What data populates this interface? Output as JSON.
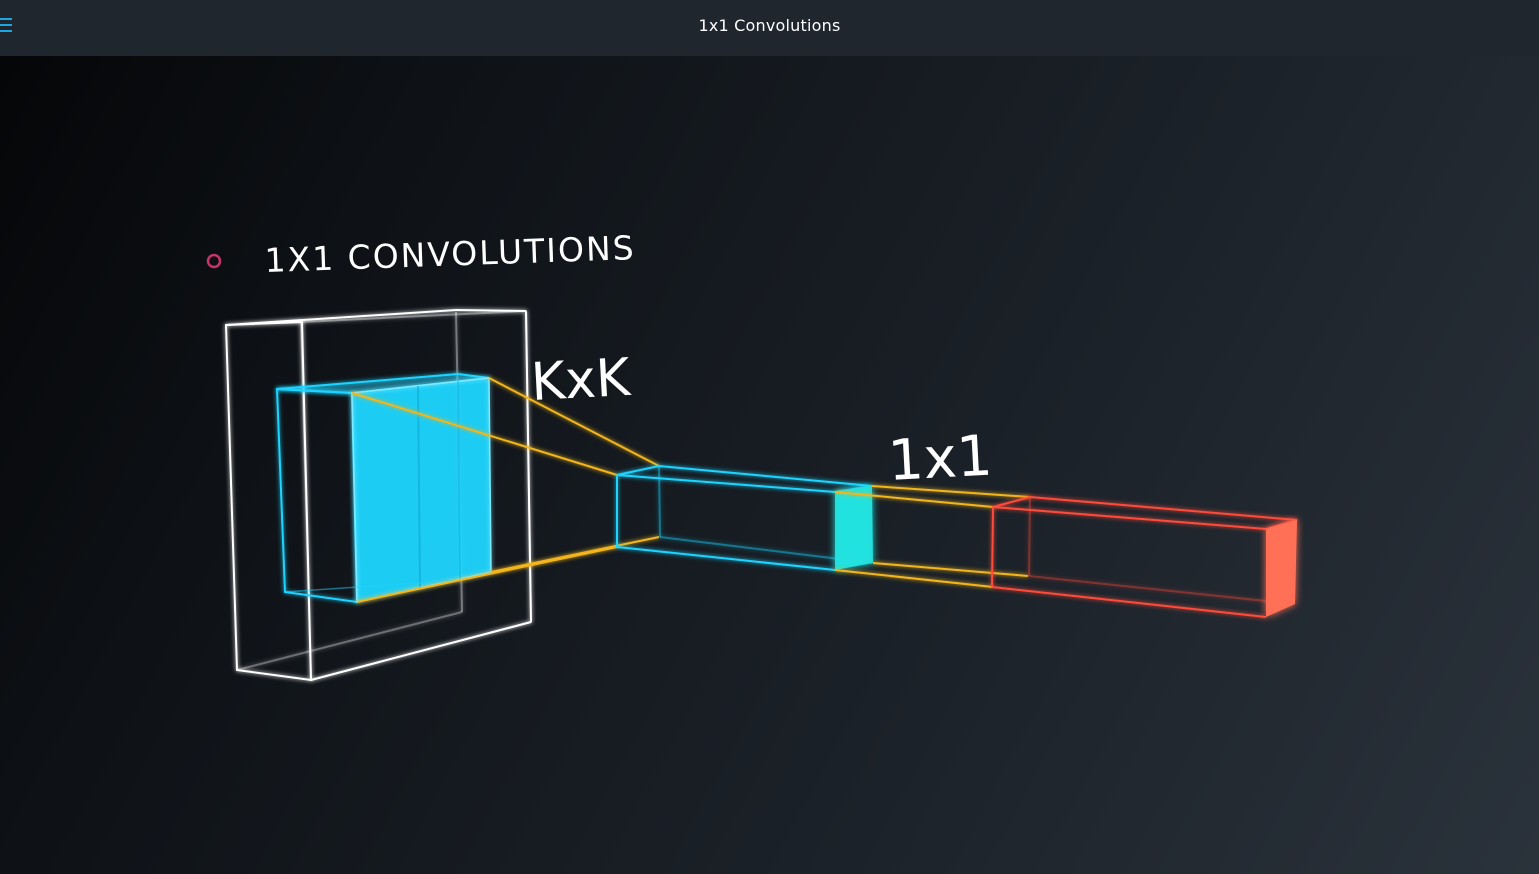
{
  "window": {
    "title": "1x1 Convolutions",
    "menu_icon": "hamburger-menu-icon"
  },
  "video": {
    "slide_heading": "1X1 CONVOLUTIONS",
    "bullet_icon": "ring-bullet-icon",
    "label_kxk": "KxK",
    "label_1x1": "1x1",
    "colors": {
      "background": "#0c0f13",
      "topbar": "#1f262e",
      "accent_menu": "#1ea6e0",
      "bullet": "#c8336b",
      "input_volume": "#ffffff",
      "kernel_cyan": "#1ed4ff",
      "projection_yellow": "#f2b61c",
      "output_red": "#ff4b3a",
      "output_face": "#ff7056"
    }
  }
}
